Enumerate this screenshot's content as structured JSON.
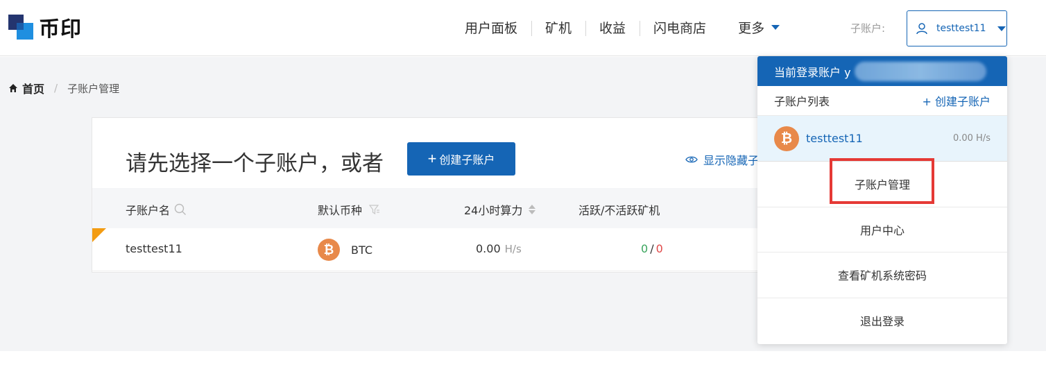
{
  "logo": {
    "text": "币印"
  },
  "nav": {
    "items": [
      "用户面板",
      "矿机",
      "收益",
      "闪电商店"
    ],
    "more_label": "更多"
  },
  "account_switcher": {
    "label": "子账户:",
    "current": "testtest11"
  },
  "breadcrumb": {
    "home": "首页",
    "separator": "/",
    "current": "子账户管理"
  },
  "card": {
    "title": "请先选择一个子账户，或者",
    "create_button": "创建子账户",
    "show_hidden": "显示隐藏子",
    "table": {
      "headers": [
        "子账户名",
        "默认币种",
        "24小时算力",
        "活跃/不活跃矿机"
      ],
      "rows": [
        {
          "name": "testtest11",
          "coin": "BTC",
          "hashrate": "0.00",
          "unit": "H/s",
          "active": "0",
          "slash": "/",
          "inactive": "0"
        }
      ]
    }
  },
  "dropdown": {
    "header": "当前登录账户 y",
    "list_title": "子账户列表",
    "create_link": "+ 创建子账户",
    "account": {
      "name": "testtest11",
      "rate": "0.00 H/s"
    },
    "menu": [
      "子账户管理",
      "用户中心",
      "查看矿机系统密码",
      "退出登录"
    ]
  },
  "colors": {
    "primary": "#1565b5",
    "btc": "#e8894a",
    "highlight": "#e53935"
  },
  "icons": {
    "btc": "₿",
    "plus": "+"
  }
}
